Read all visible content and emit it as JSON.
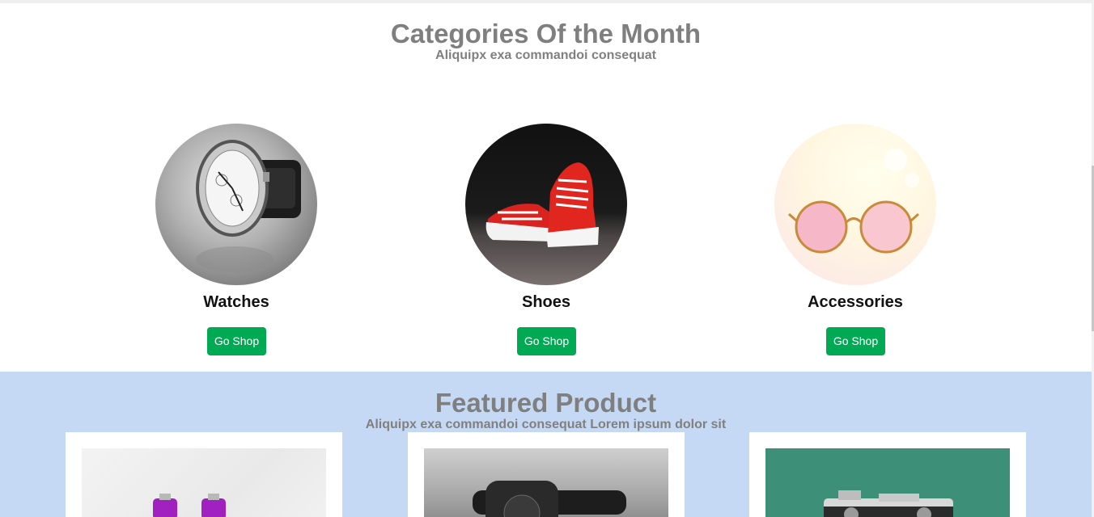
{
  "categories_section": {
    "title": "Categories Of the Month",
    "subtitle": "Aliquipx exa commandoi consequat",
    "items": [
      {
        "name": "Watches",
        "button_label": "Go Shop",
        "image_icon": "watch-image"
      },
      {
        "name": "Shoes",
        "button_label": "Go Shop",
        "image_icon": "shoes-image"
      },
      {
        "name": "Accessories",
        "button_label": "Go Shop",
        "image_icon": "glasses-image"
      }
    ]
  },
  "featured_section": {
    "title": "Featured Product",
    "subtitle": "Aliquipx exa commandoi consequat Lorem ipsum dolor sit",
    "products": [
      {
        "image_icon": "dumbbells-image"
      },
      {
        "image_icon": "smartwatch-image"
      },
      {
        "image_icon": "camera-image"
      }
    ]
  },
  "colors": {
    "button_green": "#00aa55",
    "heading_gray": "#7f7f7f",
    "featured_background": "#c6d9f4"
  }
}
